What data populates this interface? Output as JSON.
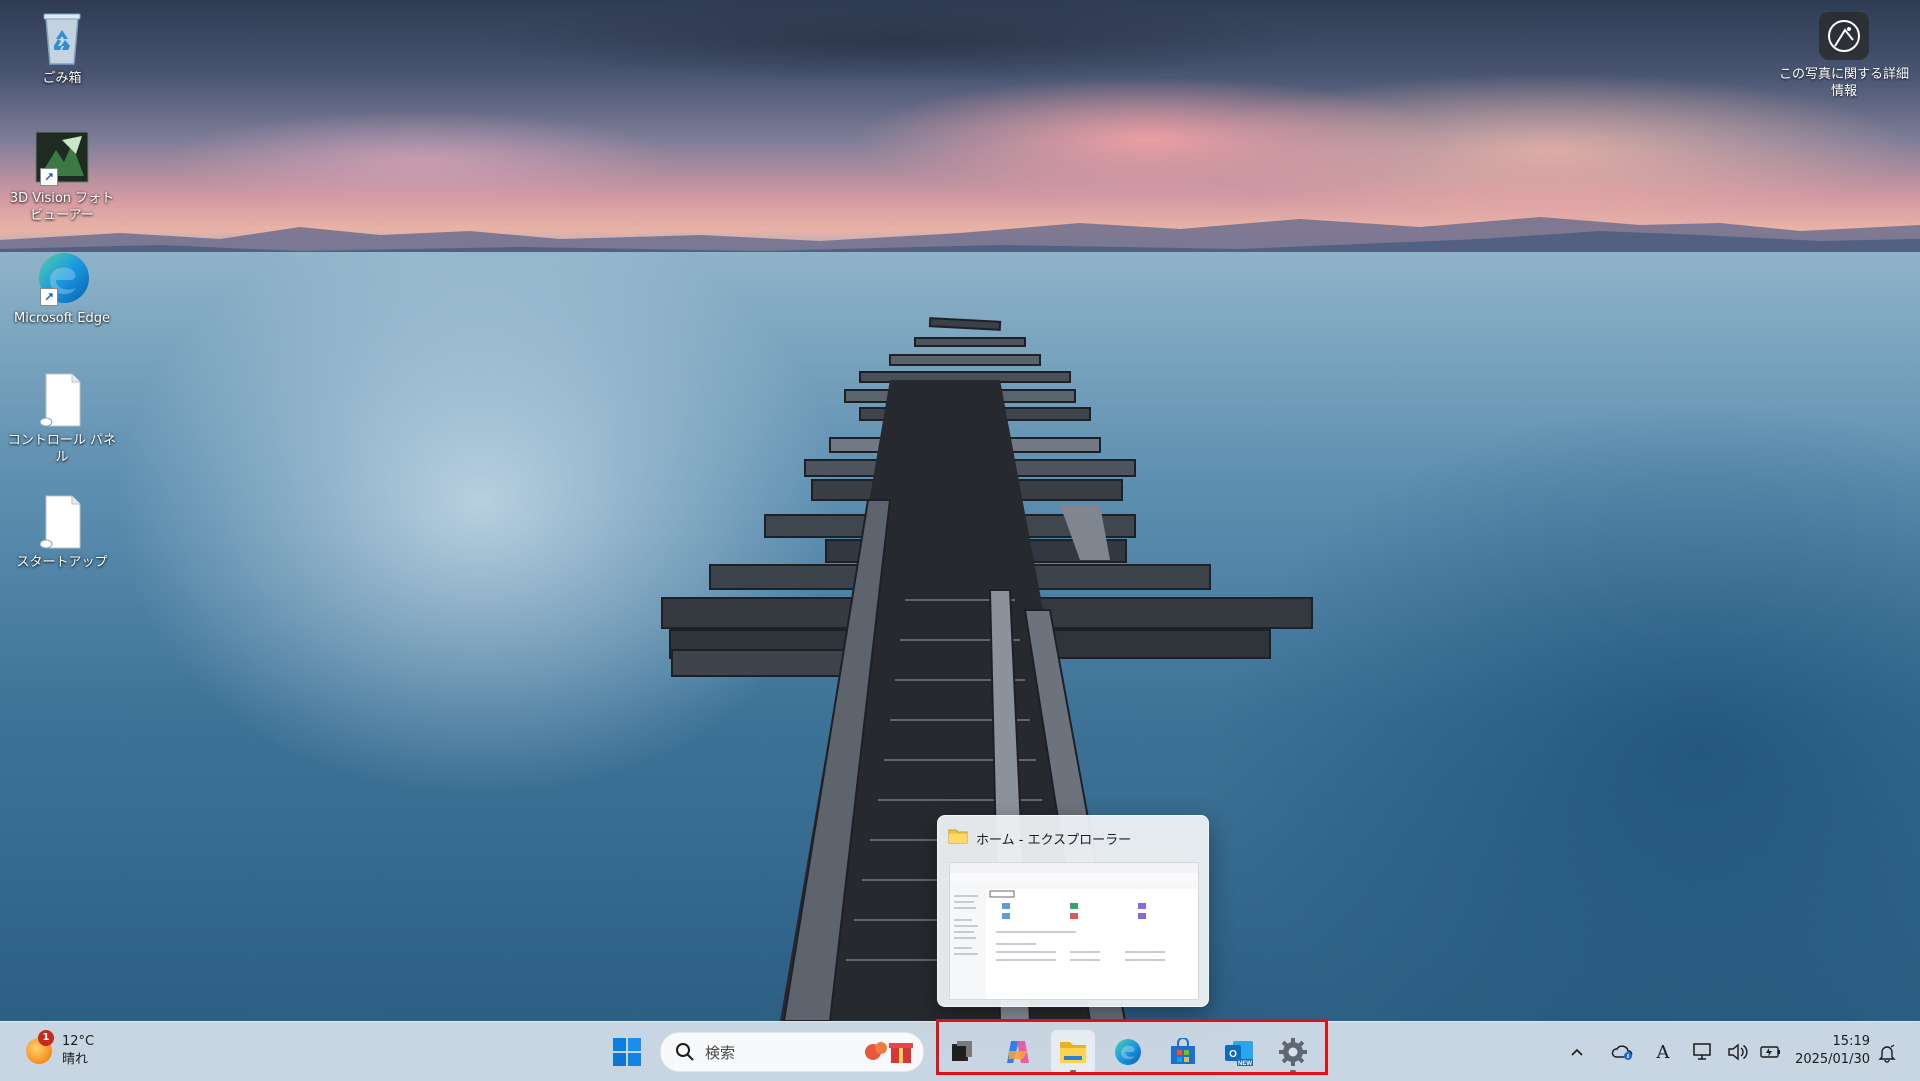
{
  "desktop": {
    "icons": [
      {
        "label": "ごみ箱",
        "icon": "recycle-bin-icon"
      },
      {
        "label": "3D Vision フォト ビューアー",
        "icon": "3d-vision-icon"
      },
      {
        "label": "Microsoft Edge",
        "icon": "edge-icon"
      },
      {
        "label": "コントロール パネル",
        "icon": "document-icon"
      },
      {
        "label": "スタートアップ",
        "icon": "document-icon"
      }
    ],
    "photo_info_label": "この写真に関する詳細情報"
  },
  "preview": {
    "title": "ホーム - エクスプローラー"
  },
  "taskbar": {
    "weather": {
      "badge": "1",
      "temperature": "12°C",
      "condition": "晴れ"
    },
    "search_placeholder": "検索",
    "pinned_apps": [
      "task-view-icon",
      "copilot-icon",
      "file-explorer-icon",
      "edge-icon",
      "microsoft-store-icon",
      "outlook-new-icon",
      "settings-icon"
    ],
    "tray": {
      "ime_label": "A"
    },
    "clock": {
      "time": "15:19",
      "date": "2025/01/30"
    }
  },
  "colors": {
    "highlight": "#e0101a",
    "taskbar_bg": "#d6e1ec",
    "accent_blue": "#0067c0"
  }
}
